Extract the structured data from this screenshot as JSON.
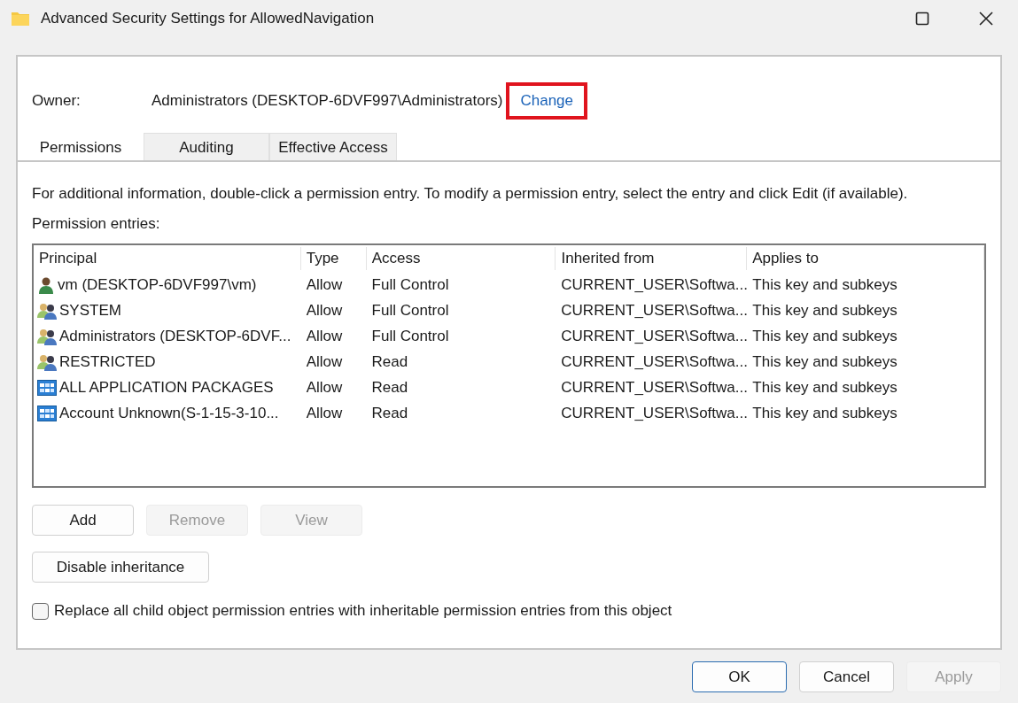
{
  "window": {
    "title": "Advanced Security Settings for AllowedNavigation"
  },
  "owner": {
    "label": "Owner:",
    "value": "Administrators (DESKTOP-6DVF997\\Administrators)",
    "change_link": {
      "label": "Change",
      "highlighted": true
    }
  },
  "tabs": [
    {
      "label": "Permissions",
      "selected": true
    },
    {
      "label": "Auditing",
      "selected": false
    },
    {
      "label": "Effective Access",
      "selected": false
    }
  ],
  "info_text": "For additional information, double-click a permission entry. To modify a permission entry, select the entry and click Edit (if available).",
  "entries_label": "Permission entries:",
  "table": {
    "columns": [
      "Principal",
      "Type",
      "Access",
      "Inherited from",
      "Applies to"
    ],
    "rows": [
      {
        "kind": "user",
        "principal": "vm (DESKTOP-6DVF997\\vm)",
        "type": "Allow",
        "access": "Full Control",
        "inherited_from": "CURRENT_USER\\Softwa...",
        "applies_to": "This key and subkeys"
      },
      {
        "kind": "group",
        "principal": "SYSTEM",
        "type": "Allow",
        "access": "Full Control",
        "inherited_from": "CURRENT_USER\\Softwa...",
        "applies_to": "This key and subkeys"
      },
      {
        "kind": "group",
        "principal": "Administrators (DESKTOP-6DVF...",
        "type": "Allow",
        "access": "Full Control",
        "inherited_from": "CURRENT_USER\\Softwa...",
        "applies_to": "This key and subkeys"
      },
      {
        "kind": "group",
        "principal": "RESTRICTED",
        "type": "Allow",
        "access": "Read",
        "inherited_from": "CURRENT_USER\\Softwa...",
        "applies_to": "This key and subkeys"
      },
      {
        "kind": "package",
        "principal": "ALL APPLICATION PACKAGES",
        "type": "Allow",
        "access": "Read",
        "inherited_from": "CURRENT_USER\\Softwa...",
        "applies_to": "This key and subkeys"
      },
      {
        "kind": "package",
        "principal": "Account Unknown(S-1-15-3-10...",
        "type": "Allow",
        "access": "Read",
        "inherited_from": "CURRENT_USER\\Softwa...",
        "applies_to": "This key and subkeys"
      }
    ]
  },
  "entry_buttons": [
    {
      "label": "Add",
      "disabled": false
    },
    {
      "label": "Remove",
      "disabled": true
    },
    {
      "label": "View",
      "disabled": true
    }
  ],
  "inheritance_button": {
    "label": "Disable inheritance"
  },
  "replace_checkbox": {
    "label": "Replace all child object permission entries with inheritable permission entries from this object",
    "checked": false
  },
  "dialog_buttons": [
    {
      "label": "OK",
      "disabled": false,
      "default": true
    },
    {
      "label": "Cancel",
      "disabled": false,
      "default": false
    },
    {
      "label": "Apply",
      "disabled": true,
      "default": false
    }
  ]
}
